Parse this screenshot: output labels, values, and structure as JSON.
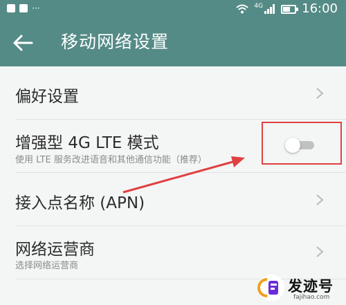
{
  "status_bar": {
    "time": "16:00",
    "network": "4G",
    "dots": "···"
  },
  "app_bar": {
    "title": "移动网络设置"
  },
  "settings": {
    "preferences": {
      "title": "偏好设置"
    },
    "lte": {
      "title": "增强型 4G LTE 模式",
      "subtitle": "使用 LTE 服务改进语音和其他通信功能（推荐）",
      "enabled": false
    },
    "apn": {
      "title": "接入点名称 (APN)"
    },
    "operator": {
      "title": "网络运营商",
      "subtitle": "选择网络运营商"
    }
  },
  "colors": {
    "header": "#558b86",
    "annotation": "#e04040",
    "background": "#f4f6f6"
  },
  "watermark": {
    "name": "发迹号",
    "url": "fajihao.com"
  }
}
